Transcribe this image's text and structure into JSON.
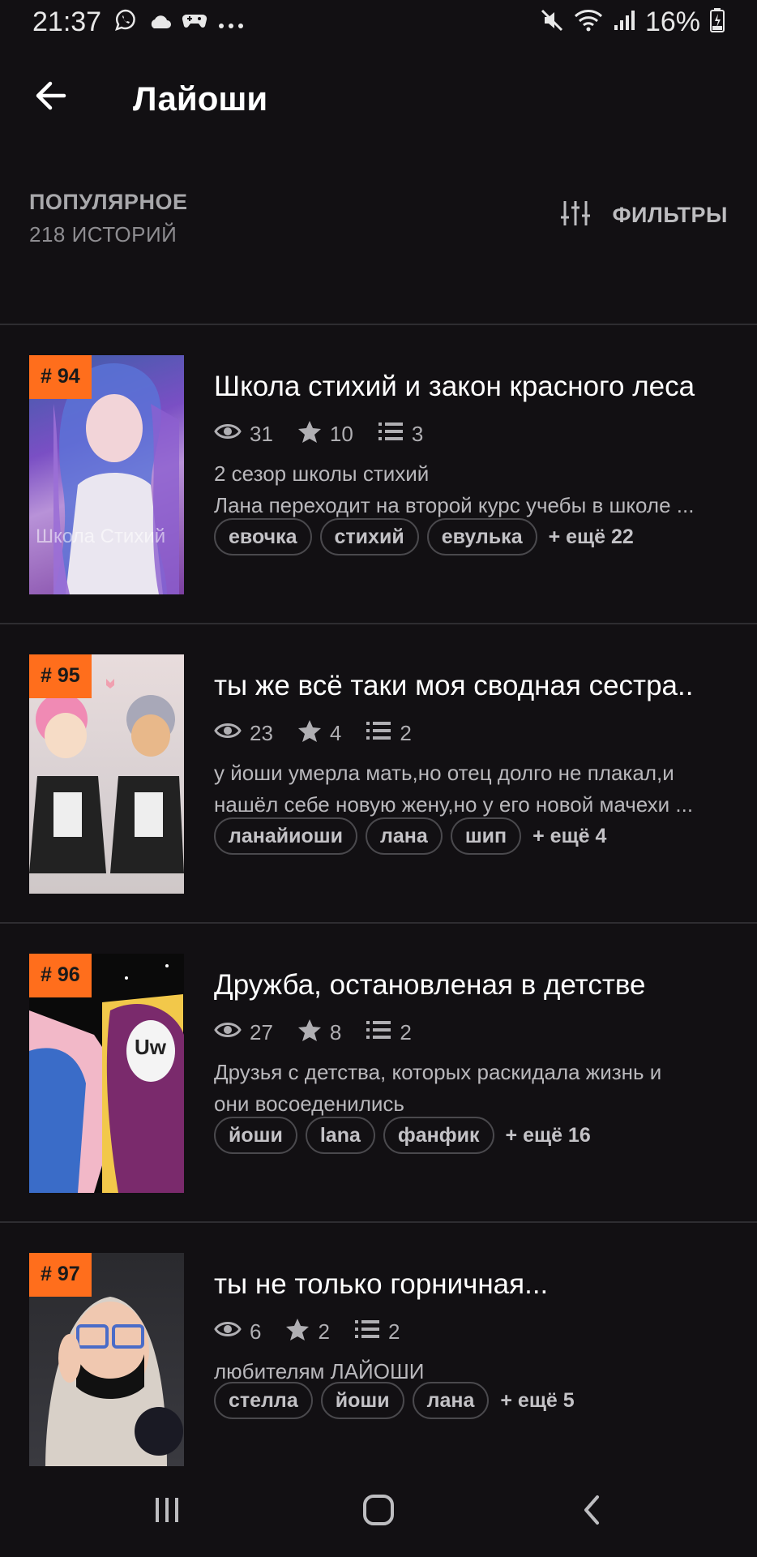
{
  "status_bar": {
    "time": "21:37",
    "battery_percent": "16%",
    "left_icons": [
      "viber-icon",
      "cloud-icon",
      "game-icon",
      "more-dots-icon"
    ],
    "right_icons": [
      "mute-icon",
      "wifi-icon",
      "signal-icon",
      "battery-charging-icon"
    ]
  },
  "appbar": {
    "title": "Лайоши"
  },
  "section": {
    "title": "ПОПУЛЯРНОЕ",
    "subtitle": "218 ИСТОРИЙ",
    "filters_label": "ФИЛЬТРЫ"
  },
  "colors": {
    "background": "#121013",
    "rank_badge": "#ff6e1c",
    "text_secondary": "#b0afb3"
  },
  "stories": [
    {
      "rank": "# 94",
      "title": "Школа стихий и закон красного леса",
      "views": "31",
      "votes": "10",
      "parts": "3",
      "desc_line1": "2 сезор школы стихий",
      "desc_line2": "Лана переходит на второй курс учебы в школе ...",
      "tags": [
        "евочка",
        "стихий",
        "евулька"
      ],
      "more": "+ ещё 22",
      "cover_text": "Школа Стихий"
    },
    {
      "rank": "# 95",
      "title": "ты же всё таки моя сводная сестра..",
      "views": "23",
      "votes": "4",
      "parts": "2",
      "desc_line1": "у йоши умерла мать,но отец долго не плакал,и",
      "desc_line2": "нашёл себе новую жену,но у его новой мачехи ...",
      "tags": [
        "ланайиоши",
        "лана",
        "шип"
      ],
      "more": "+ ещё 4"
    },
    {
      "rank": "# 96",
      "title": "Дружба, остановленая в детстве",
      "views": "27",
      "votes": "8",
      "parts": "2",
      "desc_line1": "Друзья с детства, которых раскидала жизнь и",
      "desc_line2": "они восоеденились",
      "tags": [
        "йоши",
        "lana",
        "фанфик"
      ],
      "more": "+ ещё 16",
      "cover_text": "Uw"
    },
    {
      "rank": "# 97",
      "title": "ты не только горничная...",
      "views": "6",
      "votes": "2",
      "parts": "2",
      "desc_line1": "любителям ЛАЙОШИ",
      "tags": [
        "стелла",
        "йоши",
        "лана"
      ],
      "more": "+ ещё 5"
    }
  ],
  "navbar": {
    "buttons": [
      "recents-icon",
      "home-icon",
      "back-nav-icon"
    ]
  }
}
